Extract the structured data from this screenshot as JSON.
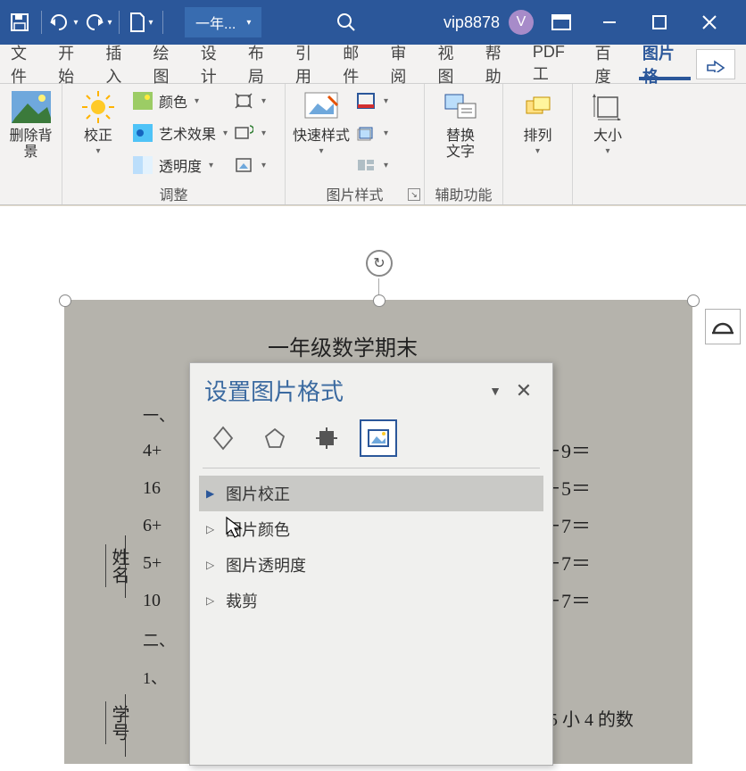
{
  "titlebar": {
    "doc_name": "一年...",
    "user_name": "vip8878",
    "user_initial": "V"
  },
  "ribbon": {
    "tabs": [
      "文件",
      "开始",
      "插入",
      "绘图",
      "设计",
      "布局",
      "引用",
      "邮件",
      "审阅",
      "视图",
      "帮助",
      "PDF工",
      "百度",
      "图片格"
    ],
    "active_tab": 13,
    "groups": {
      "g0": {
        "btn_remove_bg": "删除背景"
      },
      "g1": {
        "label": "调整",
        "btn_corrections": "校正",
        "row_color": "颜色",
        "row_art": "艺术效果",
        "row_trans": "透明度"
      },
      "g2": {
        "label": "图片样式",
        "btn_quick": "快速样式"
      },
      "g3": {
        "label": "辅助功能",
        "btn_alt": "替换\n文字"
      },
      "g4": {
        "btn_arrange": "排列"
      },
      "g5": {
        "btn_size": "大小"
      }
    }
  },
  "document": {
    "title_text": "一年级数学期末",
    "left_heads": [
      "一、",
      "",
      "",
      "",
      "",
      "",
      "二、",
      "1、"
    ],
    "left_rows": [
      "4+",
      "16",
      "6+",
      "5+",
      "10"
    ],
    "right_rows": [
      "3＋9＝",
      "5－5＝",
      "3＋7＝",
      "4－7＝",
      "9－7＝"
    ],
    "footer_fragment": "比 15 小 4 的数",
    "vertical_name": "姓名",
    "vertical_num": "学号"
  },
  "format_pane": {
    "title": "设置图片格式",
    "items": [
      "图片校正",
      "图片颜色",
      "图片透明度",
      "裁剪"
    ],
    "selected": 0
  }
}
